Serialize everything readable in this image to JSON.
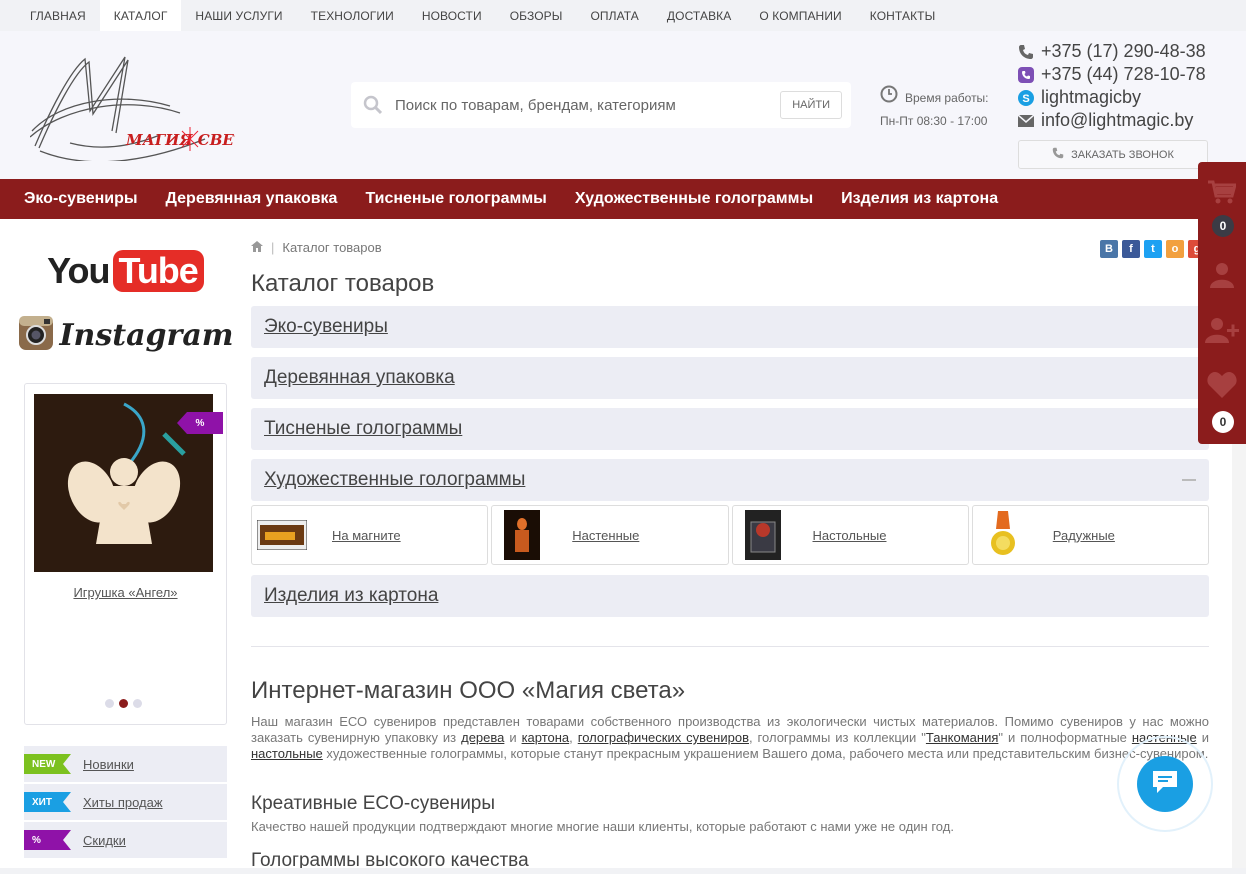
{
  "topnav": [
    "ГЛАВНАЯ",
    "КАТАЛОГ",
    "НАШИ УСЛУГИ",
    "ТЕХНОЛОГИИ",
    "НОВОСТИ",
    "ОБЗОРЫ",
    "ОПЛАТА",
    "ДОСТАВКА",
    "О КОМПАНИИ",
    "КОНТАКТЫ"
  ],
  "topnav_active": "КАТАЛОГ",
  "logo_text": "МАГИЯ СВЕТА",
  "search": {
    "placeholder": "Поиск по товарам, брендам, категориям",
    "button": "НАЙТИ"
  },
  "worktime": {
    "label": "Время работы:",
    "hours": "Пн-Пт 08:30 - 17:00"
  },
  "contacts": {
    "phone1": "+375 (17) 290-48-38",
    "phone2": "+375 (44) 728-10-78",
    "skype": "lightmagicby",
    "email": "info@lightmagic.by"
  },
  "callback_label": "ЗАКАЗАТЬ ЗВОНОК",
  "catbar": [
    "Эко-сувениры",
    "Деревянная упаковка",
    "Тисненые голограммы",
    "Художественные голограммы",
    "Изделия из картона"
  ],
  "social": {
    "youtube_you": "You",
    "youtube_tube": "Tube",
    "instagram": "Instagram"
  },
  "promo": {
    "badge": "%",
    "title": "Игрушка «Ангел»"
  },
  "tags": [
    {
      "tag": "NEW",
      "label": "Новинки",
      "color": "#7cc11f"
    },
    {
      "tag": "ХИТ",
      "label": "Хиты продаж",
      "color": "#1a9fe3"
    },
    {
      "tag": "%",
      "label": "Скидки",
      "color": "#8f12a8"
    }
  ],
  "breadcrumb": "Каталог товаров",
  "share": [
    "В",
    "f",
    "t",
    "о",
    "g"
  ],
  "page_title": "Каталог товаров",
  "catalog": [
    "Эко-сувениры",
    "Деревянная упаковка",
    "Тисненые голограммы",
    "Художественные голограммы",
    "Изделия из картона"
  ],
  "subcats": [
    "На магните",
    "Настенные",
    "Настольные",
    "Радужные"
  ],
  "shop_title": "Интернет-магазин ООО «Магия света»",
  "para": {
    "p1": "Наш магазин ЕСО сувениров представлен товарами собственного производства из экологически чистых материалов. Помимо сувениров у нас можно заказать сувенирную упаковку из ",
    "l1": "дерева",
    "p2": " и ",
    "l2": "картона",
    "p3": ", ",
    "l3": "голографических сувениров",
    "p4": ", голограммы из коллекции \"",
    "l4": "Танкомания",
    "p5": "\" и полноформатные ",
    "l5": "настенные",
    "p6": " и ",
    "l6": "настольные",
    "p7": " художественные голограммы, которые станут прекрасным украшением Вашего дома, рабочего места или представительским бизнес-сувениром."
  },
  "h_creative": "Креативные ECO-сувениры",
  "creative_text": "Качество нашей продукции подтверждают многие многие наши клиенты, которые работают с нами уже не один год.",
  "h_quality": "Голограммы высокого качества",
  "panel": {
    "cart_count": "0",
    "fav_count": "0"
  }
}
